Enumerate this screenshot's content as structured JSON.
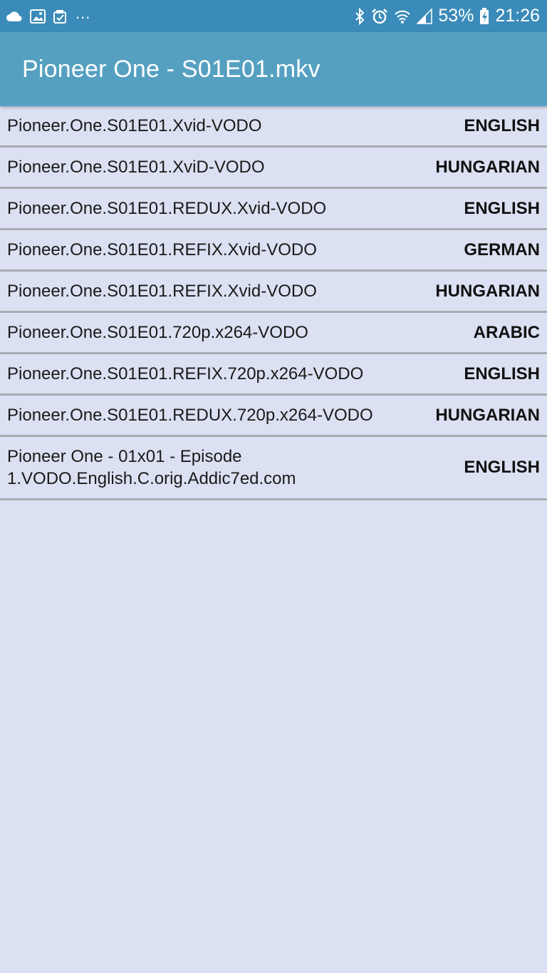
{
  "status_bar": {
    "left_icons": [
      "cloud-icon",
      "image-icon",
      "clipboard-check-icon"
    ],
    "overflow": "...",
    "right_icons": [
      "bluetooth-icon",
      "alarm-icon",
      "wifi-icon",
      "signal-icon",
      "battery-charging-icon"
    ],
    "battery": "53%",
    "time": "21:26"
  },
  "app_bar": {
    "title": "Pioneer One - S01E01.mkv",
    "color": "#55a0c1"
  },
  "subtitles": [
    {
      "name": "Pioneer.One.S01E01.Xvid-VODO",
      "language": "ENGLISH"
    },
    {
      "name": "Pioneer.One.S01E01.XviD-VODO",
      "language": "HUNGARIAN"
    },
    {
      "name": "Pioneer.One.S01E01.REDUX.Xvid-VODO",
      "language": "ENGLISH"
    },
    {
      "name": "Pioneer.One.S01E01.REFIX.Xvid-VODO",
      "language": "GERMAN"
    },
    {
      "name": "Pioneer.One.S01E01.REFIX.Xvid-VODO",
      "language": "HUNGARIAN"
    },
    {
      "name": "Pioneer.One.S01E01.720p.x264-VODO",
      "language": "ARABIC"
    },
    {
      "name": "Pioneer.One.S01E01.REFIX.720p.x264-VODO",
      "language": "ENGLISH"
    },
    {
      "name": "Pioneer.One.S01E01.REDUX.720p.x264-VODO",
      "language": "HUNGARIAN"
    },
    {
      "name": "Pioneer One - 01x01 - Episode 1.VODO.English.C.orig.Addic7ed.com",
      "language": "ENGLISH"
    }
  ]
}
